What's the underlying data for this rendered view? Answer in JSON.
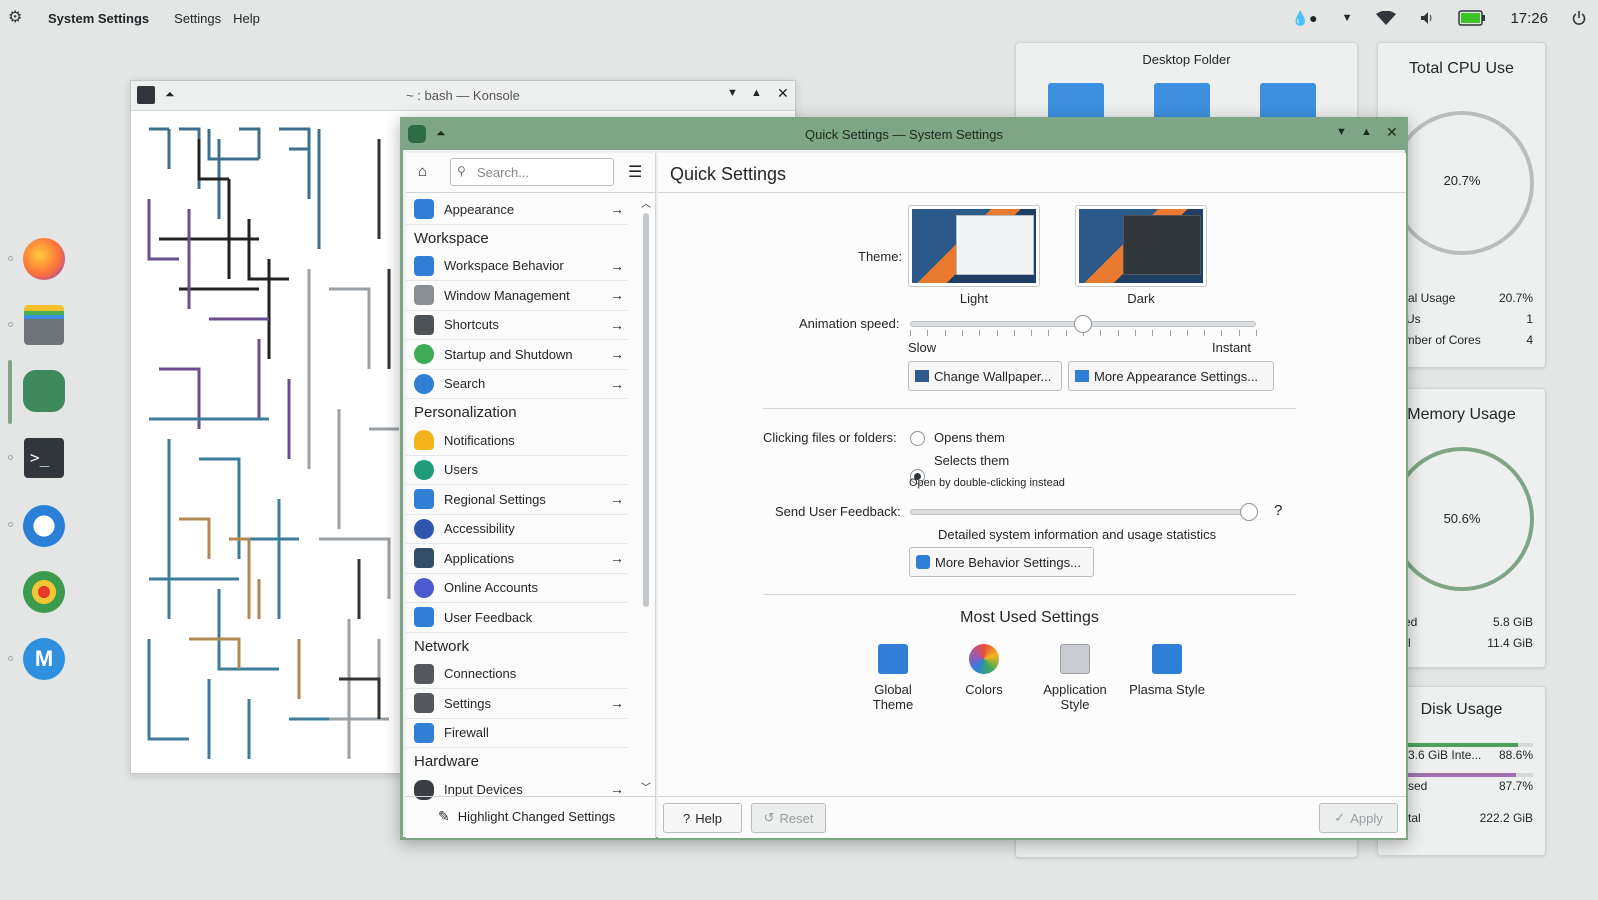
{
  "topbar": {
    "app_name": "System Settings",
    "menus": [
      "Settings",
      "Help"
    ],
    "clock": "17:26"
  },
  "konsole": {
    "title": "~ : bash — Konsole"
  },
  "desktop_folder": {
    "title": "Desktop Folder"
  },
  "cpu_widget": {
    "title": "Total CPU Use",
    "gauge": "20.7%",
    "rows": [
      {
        "label": "otal Usage",
        "value": "20.7%"
      },
      {
        "label": "PUs",
        "value": "1"
      },
      {
        "label": "umber of Cores",
        "value": "4"
      }
    ]
  },
  "memory_widget": {
    "title": "Memory Usage",
    "gauge": "50.6%",
    "rows": [
      {
        "label": "sed",
        "value": "5.8 GiB"
      },
      {
        "label": "tal",
        "value": "11.4 GiB"
      }
    ]
  },
  "disk_widget": {
    "title": "Disk Usage",
    "rows": [
      {
        "label": "3.6 GiB Inte...",
        "value": "88.6%"
      },
      {
        "label": "sed",
        "value": "87.7%"
      },
      {
        "label": "tal",
        "value": "222.2 GiB"
      }
    ],
    "bar1_fill": 0.886,
    "bar2_fill": 0.877
  },
  "settings_window": {
    "title": "Quick Settings — System Settings",
    "search_placeholder": "Search...",
    "sidebar": {
      "appearance": "Appearance",
      "cat_workspace": "Workspace",
      "workspace_behavior": "Workspace Behavior",
      "window_management": "Window Management",
      "shortcuts": "Shortcuts",
      "startup_shutdown": "Startup and Shutdown",
      "search": "Search",
      "cat_personalization": "Personalization",
      "notifications": "Notifications",
      "users": "Users",
      "regional": "Regional Settings",
      "accessibility": "Accessibility",
      "applications": "Applications",
      "online_accounts": "Online Accounts",
      "user_feedback": "User Feedback",
      "cat_network": "Network",
      "connections": "Connections",
      "net_settings": "Settings",
      "firewall": "Firewall",
      "cat_hardware": "Hardware",
      "input_devices": "Input Devices",
      "highlight": "Highlight Changed Settings"
    },
    "page_title": "Quick Settings",
    "theme_label": "Theme:",
    "theme_light": "Light",
    "theme_dark": "Dark",
    "animation_label": "Animation speed:",
    "slow": "Slow",
    "instant": "Instant",
    "animation_value": 0.5,
    "change_wallpaper": "Change Wallpaper...",
    "more_appearance": "More Appearance Settings...",
    "clicking_label": "Clicking files or folders:",
    "opens_them": "Opens them",
    "selects_them": "Selects them",
    "open_hint": "Open by double-clicking instead",
    "feedback_label": "Send User Feedback:",
    "feedback_help": "?",
    "feedback_desc": "Detailed system information and usage statistics",
    "more_behavior": "More Behavior Settings...",
    "most_used_title": "Most Used Settings",
    "most_used": [
      "Global\nTheme",
      "Colors",
      "Application\nStyle",
      "Plasma Style"
    ],
    "help": "Help",
    "reset": "Reset",
    "apply": "Apply"
  }
}
